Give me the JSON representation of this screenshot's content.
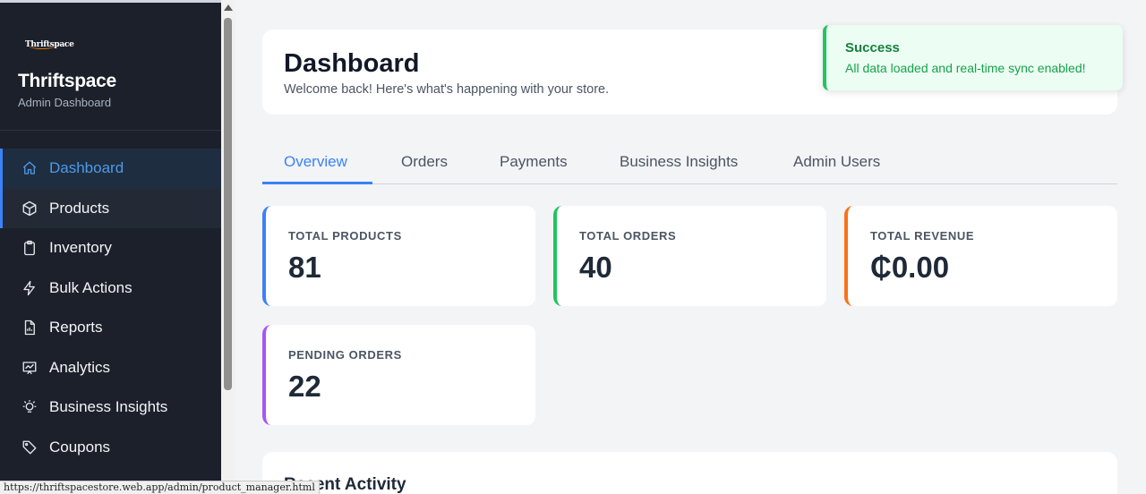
{
  "sidebar": {
    "logo_text": "Thriftspace",
    "brand": "Thriftspace",
    "subtitle": "Admin Dashboard",
    "items": [
      {
        "label": "Dashboard",
        "icon": "home-icon",
        "active": true
      },
      {
        "label": "Products",
        "icon": "box-icon"
      },
      {
        "label": "Inventory",
        "icon": "clipboard-icon"
      },
      {
        "label": "Bulk Actions",
        "icon": "bolt-icon"
      },
      {
        "label": "Reports",
        "icon": "document-icon"
      },
      {
        "label": "Analytics",
        "icon": "chart-icon"
      },
      {
        "label": "Business Insights",
        "icon": "lightbulb-icon"
      },
      {
        "label": "Coupons",
        "icon": "tag-icon"
      }
    ]
  },
  "header": {
    "title": "Dashboard",
    "subtitle": "Welcome back! Here's what's happening with your store."
  },
  "tabs": [
    {
      "label": "Overview",
      "active": true
    },
    {
      "label": "Orders"
    },
    {
      "label": "Payments"
    },
    {
      "label": "Business Insights"
    },
    {
      "label": "Admin Users"
    }
  ],
  "stats": [
    {
      "label": "TOTAL PRODUCTS",
      "value": "81",
      "color": "#3b82f6"
    },
    {
      "label": "TOTAL ORDERS",
      "value": "40",
      "color": "#22c55e"
    },
    {
      "label": "TOTAL REVENUE",
      "value": "₵0.00",
      "color": "#f97316"
    },
    {
      "label": "PENDING ORDERS",
      "value": "22",
      "color": "#a855f7"
    }
  ],
  "activity": {
    "title": "Recent Activity"
  },
  "toast": {
    "title": "Success",
    "message": "All data loaded and real-time sync enabled!"
  },
  "status_url": "https://thriftspacestore.web.app/admin/product_manager.html"
}
